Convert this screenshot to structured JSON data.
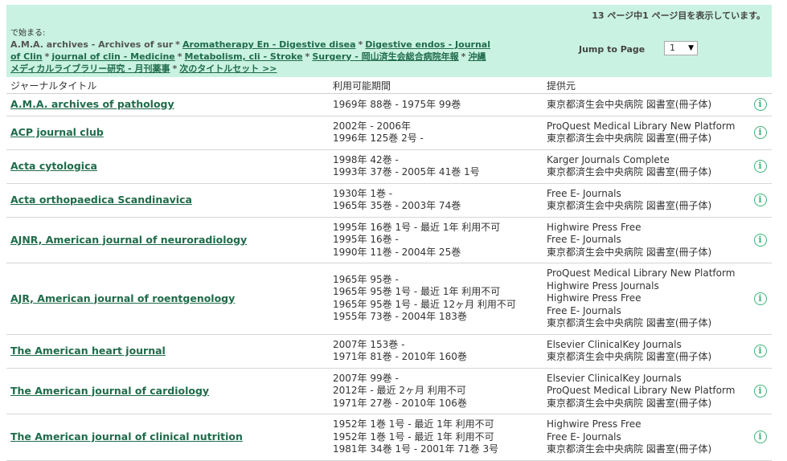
{
  "header": {
    "page_info": "13 ページ中1 ページ目を表示しています。",
    "starts_with_label": "で始まる:",
    "nav": [
      {
        "text": "A.M.A. archives - Archives of sur",
        "link": false
      },
      {
        "text": "Aromatherapy En - Digestive disea",
        "link": true
      },
      {
        "text": "Digestive endos - Journal of Clin",
        "link": true
      },
      {
        "text": "journal of clin - Medicine",
        "link": true
      },
      {
        "text": "Metabolism, cli - Stroke",
        "link": true
      },
      {
        "text": "Surgery - 岡山済生会総合病院年報",
        "link": true
      },
      {
        "text": "沖縄メディカルライブラリー研究 - 月刊薬事",
        "link": true
      },
      {
        "text": "次のタイトルセット >>",
        "link": true
      }
    ],
    "jump_label": "Jump to Page",
    "jump_value": "1"
  },
  "table": {
    "columns": [
      "ジャーナルタイトル",
      "利用可能期間",
      "提供元"
    ],
    "rows": [
      {
        "title": "A.M.A. archives of pathology",
        "periods": [
          "1969年 88巻 - 1975年 99巻"
        ],
        "providers": [
          "東京都済生会中央病院 図書室(冊子体)"
        ]
      },
      {
        "title": "ACP journal club",
        "periods": [
          "2002年 - 2006年",
          "1996年 125巻 2号 -"
        ],
        "providers": [
          "ProQuest Medical Library New Platform",
          "東京都済生会中央病院 図書室(冊子体)"
        ]
      },
      {
        "title": "Acta cytologica",
        "periods": [
          "1998年 42巻 -",
          "1993年 37巻 - 2005年 41巻 1号"
        ],
        "providers": [
          "Karger Journals Complete",
          "東京都済生会中央病院 図書室(冊子体)"
        ]
      },
      {
        "title": "Acta orthopaedica Scandinavica",
        "periods": [
          "1930年 1巻 -",
          "1965年 35巻 - 2003年 74巻"
        ],
        "providers": [
          "Free E- Journals",
          "東京都済生会中央病院 図書室(冊子体)"
        ]
      },
      {
        "title": "AJNR, American journal of neuroradiology",
        "periods": [
          "1995年 16巻 1号 - 最近 1年 利用不可",
          "1995年 16巻 -",
          "1990年 11巻 - 2004年 25巻"
        ],
        "providers": [
          "Highwire Press Free",
          "Free E- Journals",
          "東京都済生会中央病院 図書室(冊子体)"
        ]
      },
      {
        "title": "AJR, American journal of roentgenology",
        "periods": [
          "1965年 95巻 -",
          "1965年 95巻 1号 - 最近 1年 利用不可",
          "1965年 95巻 1号 - 最近 12ヶ月 利用不可",
          "1955年 73巻 - 2004年 183巻"
        ],
        "providers": [
          "ProQuest Medical Library New Platform",
          "Highwire Press Journals",
          "Highwire Press Free",
          "Free E- Journals",
          "東京都済生会中央病院 図書室(冊子体)"
        ]
      },
      {
        "title": "The American heart journal",
        "periods": [
          "2007年 153巻 -",
          "1971年 81巻 - 2010年 160巻"
        ],
        "providers": [
          "Elsevier ClinicalKey Journals",
          "東京都済生会中央病院 図書室(冊子体)"
        ]
      },
      {
        "title": "The American journal of cardiology",
        "periods": [
          "2007年 99巻 -",
          "2012年 - 最近 2ヶ月 利用不可",
          "1971年 27巻 - 2010年 106巻"
        ],
        "providers": [
          "Elsevier ClinicalKey Journals",
          "ProQuest Medical Library New Platform",
          "東京都済生会中央病院 図書室(冊子体)"
        ]
      },
      {
        "title": "The American journal of clinical nutrition",
        "periods": [
          "1952年 1巻 1号 - 最近 1年 利用不可",
          "1952年 1巻 1号 - 最近 1年 利用不可",
          "1981年 34巻 1号 - 2001年 71巻 3号"
        ],
        "providers": [
          "Highwire Press Free",
          "Free E- Journals",
          "東京都済生会中央病院 図書室(冊子体)"
        ]
      }
    ]
  },
  "icons": {
    "info": "info-icon"
  },
  "colors": {
    "header_bg": "#c9f2e2",
    "link": "#1f6b4b",
    "icon": "#3db37a"
  }
}
